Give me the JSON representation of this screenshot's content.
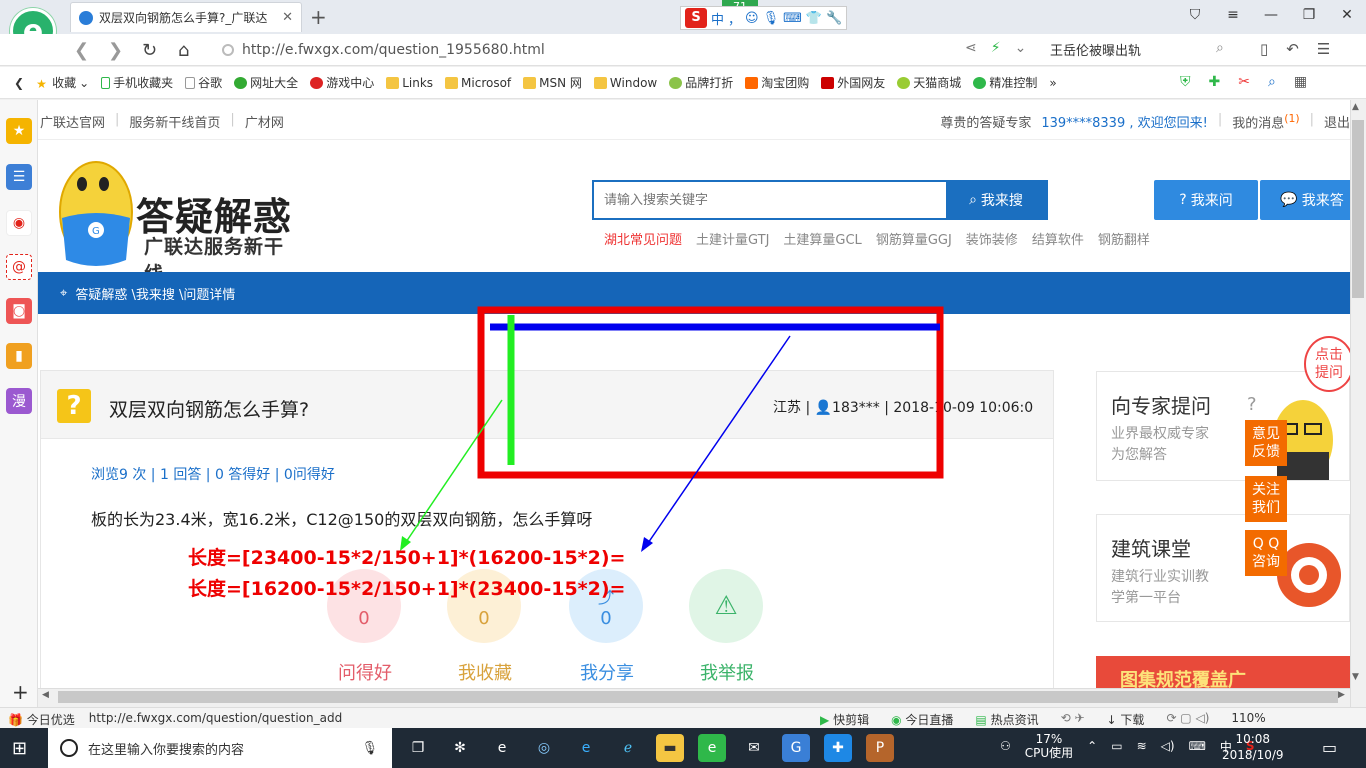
{
  "browser": {
    "tab_title": "双层双向钢筋怎么手算?_广联达",
    "tab_close": "✕",
    "new_tab": "+",
    "ime_label": "中",
    "ime_dot": "，",
    "ime_badge": "71",
    "url": "http://e.fwxgx.com/question_1955680.html",
    "hot_search": "王岳伦被曝出轨",
    "bookmarks": [
      "收藏",
      "手机收藏夹",
      "谷歌",
      "网址大全",
      "游戏中心",
      "Links",
      "Microsof",
      "MSN 网",
      "Window",
      "品牌打折",
      "淘宝团购",
      "外国网友",
      "天猫商城",
      "精准控制"
    ]
  },
  "sidebar": {
    "icons": [
      "star-icon",
      "news-icon",
      "weibo-icon",
      "mail-icon",
      "game-icon",
      "book-icon",
      "comic-icon"
    ],
    "comic_label": "漫"
  },
  "site": {
    "top_links": [
      "广联达官网",
      "服务新干线首页",
      "广材网"
    ],
    "welcome": "尊贵的答疑专家",
    "user": "139****8339 , 欢迎您回来!",
    "messages": "我的消息",
    "messages_count": "(1)",
    "logout": "退出",
    "logo_name": "答疑解惑",
    "logo_sub": "广联达服务新干线",
    "search_placeholder": "请输入搜索关键字",
    "search_btn": "我来搜",
    "ask_btn": "我来问",
    "answer_btn": "我来答",
    "hot_links": [
      "湖北常见问题",
      "土建计量GTJ",
      "土建算量GCL",
      "钢筋算量GGJ",
      "装饰装修",
      "结算软件",
      "钢筋翻样"
    ],
    "breadcrumb": "答疑解惑 \\我来搜 \\问题详情"
  },
  "question": {
    "mark": "?",
    "title": "双层双向钢筋怎么手算?",
    "meta": "江苏 | 👤183*** | 2018-10-09 10:06:0",
    "stats": "浏览9 次 | 1 回答 | 0 答得好 | 0问得好",
    "body": "板的长为23.4米，宽16.2米，C12@150的双层双向钢筋，怎么手算呀",
    "actions": [
      {
        "label": "问得好",
        "count": "0"
      },
      {
        "label": "我收藏",
        "count": "0"
      },
      {
        "label": "我分享",
        "count": "0"
      },
      {
        "label": "我举报",
        "count": ""
      }
    ]
  },
  "right": {
    "expert_title": "向专家提问",
    "expert_sub1": "业界最权威专家",
    "expert_sub2": "为您解答",
    "course_title": "建筑课堂",
    "course_sub1": "建筑行业实训教",
    "course_sub2": "学第一平台",
    "click_hint1": "点击",
    "click_hint2": "提问",
    "float_btns": [
      "意见\n反馈",
      "关注\n我们",
      "Q Q\n咨询"
    ],
    "banner": "图集规范覆盖广"
  },
  "annotations": {
    "formula1": "长度=[23400-15*2/150+1]*(16200-15*2)=",
    "formula2": "长度=[16200-15*2/150+1]*(23400-15*2)="
  },
  "statusbar": {
    "left": [
      "今日优选",
      "http://e.fwxgx.com/question/question_add"
    ],
    "right": [
      "快剪辑",
      "今日直播",
      "热点资讯",
      "下载",
      "110%"
    ]
  },
  "taskbar": {
    "search_placeholder": "在这里输入你要搜索的内容",
    "cpu": "17%",
    "cpu_label": "CPU使用",
    "ime": "中",
    "time": "10:08",
    "date": "2018/10/9"
  }
}
